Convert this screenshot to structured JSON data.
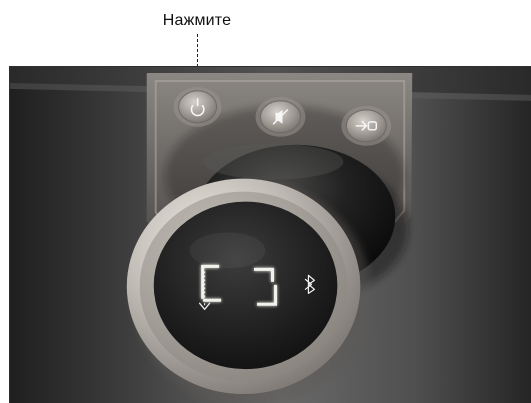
{
  "caption": {
    "text": "Нажмите"
  },
  "icons": {
    "power": "power-icon",
    "mute": "mute-icon",
    "source": "source-icon",
    "bluetooth": "bluetooth-icon"
  },
  "colors": {
    "panel_dark": "#2d2d2d",
    "panel_mid": "#777777",
    "knob_ring": "#c7c1bc",
    "button_face": "#bbb4ae",
    "display_glow": "#f3f3ee"
  }
}
